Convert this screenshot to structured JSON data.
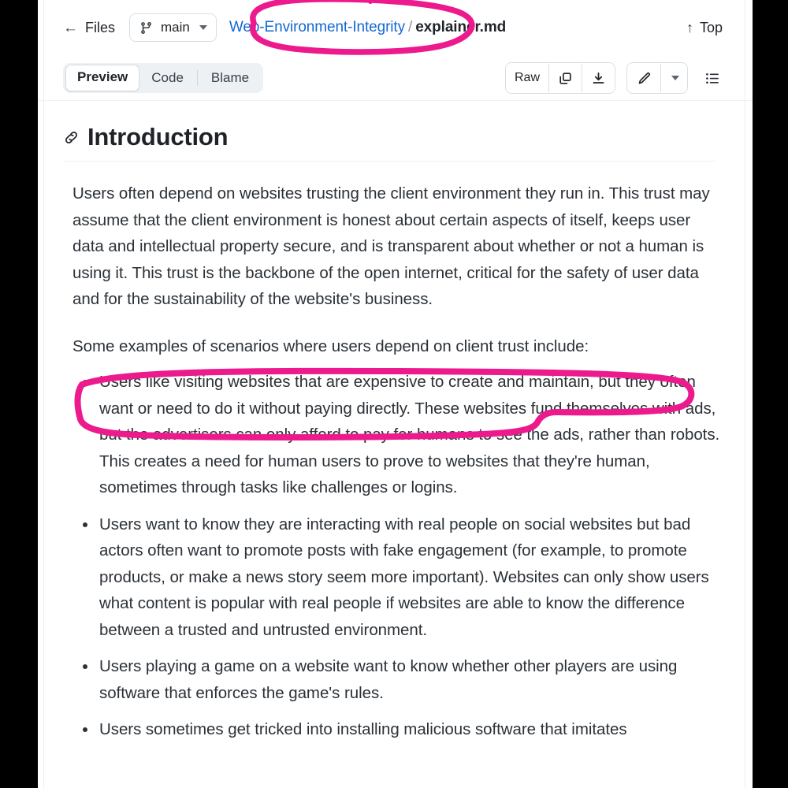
{
  "window": {
    "background_color": "#000000",
    "page_background": "#ffffff"
  },
  "header": {
    "back_icon": "left-arrow-icon",
    "files_label": "Files",
    "branch_icon": "git-branch-icon",
    "branch_name": "main",
    "branch_caret_icon": "chevron-down-icon",
    "breadcrumb": {
      "repo": "Web-Environment-Integrity",
      "separator": "/",
      "file": "explainer.md",
      "repo_link_color": "#1268d3"
    },
    "top_label": "Top",
    "top_icon": "up-arrow-icon"
  },
  "toolbar": {
    "tabs": [
      {
        "label": "Preview",
        "active": true
      },
      {
        "label": "Code",
        "active": false
      },
      {
        "label": "Blame",
        "active": false
      }
    ],
    "raw_label": "Raw",
    "copy_icon": "copy-icon",
    "download_icon": "download-icon",
    "edit_icon": "pencil-icon",
    "edit_caret_icon": "chevron-down-icon",
    "outline_icon": "list-outline-icon"
  },
  "document": {
    "anchor_icon": "link-anchor-icon",
    "heading": "Introduction",
    "paragraphs": [
      "Users often depend on websites trusting the client environment they run in. This trust may assume that the client environment is honest about certain aspects of itself, keeps user data and intellectual property secure, and is transparent about whether or not a human is using it. This trust is the backbone of the open internet, critical for the safety of user data and for the sustainability of the website's business.",
      "Some examples of scenarios where users depend on client trust include:"
    ],
    "bullets": [
      "Users like visiting websites that are expensive to create and maintain, but they often want or need to do it without paying directly. These websites fund themselves with ads, but the advertisers can only afford to pay for humans to see the ads, rather than robots. This creates a need for human users to prove to websites that they're human, sometimes through tasks like challenges or logins.",
      "Users want to know they are interacting with real people on social websites but bad actors often want to promote posts with fake engagement (for example, to promote products, or make a news story seem more important). Websites can only show users what content is popular with real people if websites are able to know the difference between a trusted and untrusted environment.",
      "Users playing a game on a website want to know whether other players are using software that enforces the game's rules.",
      "Users sometimes get tricked into installing malicious software that imitates"
    ]
  },
  "annotations": {
    "color": "#ec1a8d",
    "items": [
      {
        "name": "breadcrumb-repo-circle",
        "target": "Web-Environment-Integrity"
      },
      {
        "name": "first-bullet-lasso",
        "target": "Users like visiting websites that are expensive to create and maintain, but they often want or need to do it without paying directly."
      }
    ]
  }
}
